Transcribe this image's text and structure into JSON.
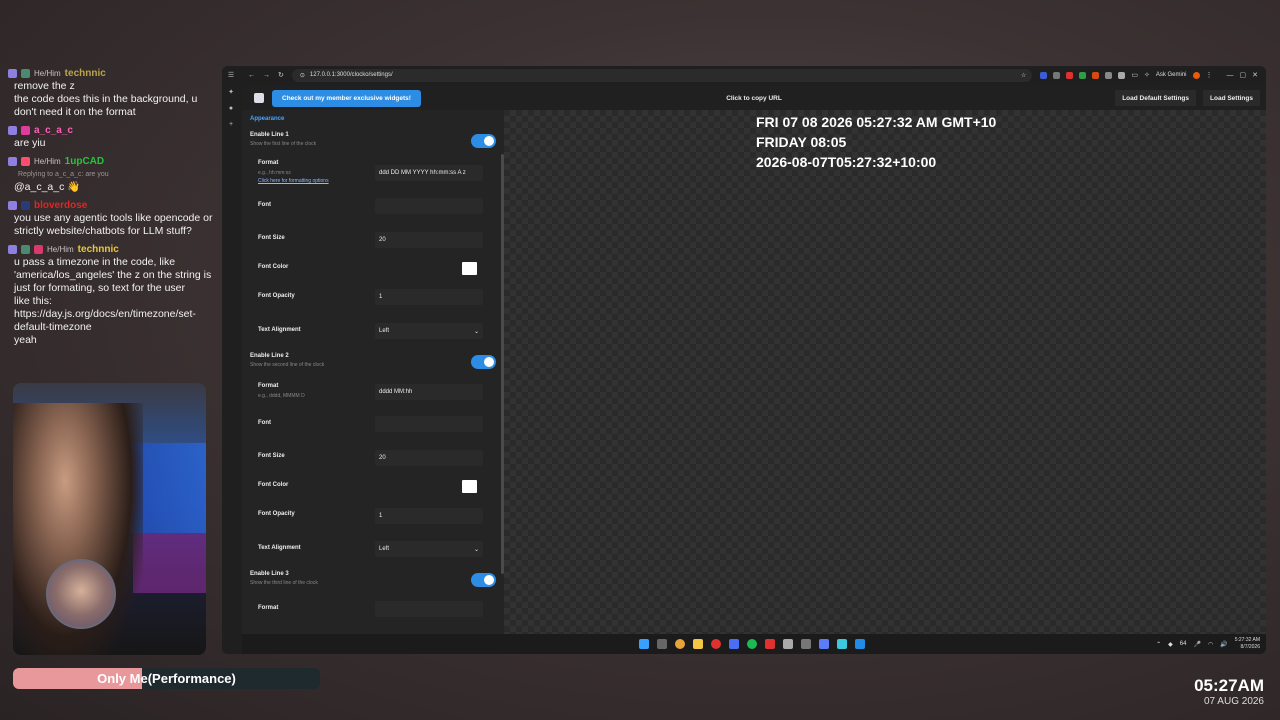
{
  "chat": {
    "messages": [
      {
        "pronoun": "He/Him",
        "user": "technnic",
        "user_color": "#b9a64b",
        "lines": [
          "remove the z",
          "the code does this in the background, u don't need it on the format"
        ],
        "badges": [
          "#8f7fe0",
          "#4b8a6e"
        ]
      },
      {
        "pronoun": "",
        "user": "a_c_a_c",
        "user_color": "#ff5fb8",
        "lines": [
          "are yiu"
        ],
        "badges": [
          "#8f7fe0",
          "#e03c9b"
        ]
      },
      {
        "pronoun": "He/Him",
        "user": "1upCAD",
        "user_color": "#27c43c",
        "reply": "Replying to a_c_a_c: are you",
        "lines": [
          "@a_c_a_c 👋"
        ],
        "badges": [
          "#8f7fe0",
          "#ff4d6d"
        ]
      },
      {
        "pronoun": "",
        "user": "bloverdose",
        "user_color": "#e02525",
        "lines": [
          "you use any agentic tools like opencode or strictly website/chatbots for LLM stuff?"
        ],
        "badges": [
          "#8f7fe0",
          "#2a3b7a"
        ]
      },
      {
        "pronoun": "He/Him",
        "user": "technnic",
        "user_color": "#e8c840",
        "lines": [
          "u pass a timezone in the code, like 'america/los_angeles' the z on the string is just for formating, so text for the user",
          "like this:",
          "https://day.js.org/docs/en/timezone/set-default-timezone",
          "yeah"
        ],
        "badges": [
          "#8f7fe0",
          "#4b8a6e",
          "#d93a6a"
        ]
      }
    ]
  },
  "perf_bar": {
    "label_a": "Only Me",
    "label_b": " (Performance)",
    "fill_fraction": 0.42,
    "fill_color": "#e8989b"
  },
  "stream_clock": {
    "time": "05:27AM",
    "date": "07 AUG 2026"
  },
  "browser": {
    "url": "127.0.0.1:3000/clocko/settings/",
    "ask_gemini": "Ask Gemini",
    "member_button": "Check out my member exclusive widgets!",
    "copy_url": "Click to copy URL",
    "load_default": "Load Default Settings",
    "load_settings": "Load Settings"
  },
  "settings": {
    "section": "Appearance",
    "line1": {
      "enable_label": "Enable Line 1",
      "enable_hint": "Show the first line of the clock",
      "format_label": "Format",
      "format_hint": "e.g., hh:mm:ss",
      "format_link": "Click here for formatting options",
      "format_value": "ddd DD MM YYYY hh:mm:ss A z",
      "font_label": "Font",
      "font_value": "",
      "size_label": "Font Size",
      "size_value": "20",
      "color_label": "Font Color",
      "color_value": "#ffffff",
      "opacity_label": "Font Opacity",
      "opacity_value": "1",
      "align_label": "Text Alignment",
      "align_value": "Left"
    },
    "line2": {
      "enable_label": "Enable Line 2",
      "enable_hint": "Show the second line of the clock",
      "format_label": "Format",
      "format_hint": "e.g., dddd, MMMM D",
      "format_value": "dddd MM:hh",
      "font_label": "Font",
      "font_value": "",
      "size_label": "Font Size",
      "size_value": "20",
      "color_label": "Font Color",
      "color_value": "#ffffff",
      "opacity_label": "Font Opacity",
      "opacity_value": "1",
      "align_label": "Text Alignment",
      "align_value": "Left"
    },
    "line3": {
      "enable_label": "Enable Line 3",
      "enable_hint": "Show the third line of the clock",
      "format_label": "Format"
    }
  },
  "preview": {
    "line1": "FRI 07 08 2026 05:27:32 AM GMT+10",
    "line2": "FRIDAY 08:05",
    "line3": "2026-08-07T05:27:32+10:00"
  },
  "taskbar": {
    "tray_time": "5:27:32 AM",
    "tray_date": "8/7/2026",
    "tray_num": "64"
  },
  "colors": {
    "accent": "#2d8ce3",
    "link": "#4aa3ff"
  }
}
